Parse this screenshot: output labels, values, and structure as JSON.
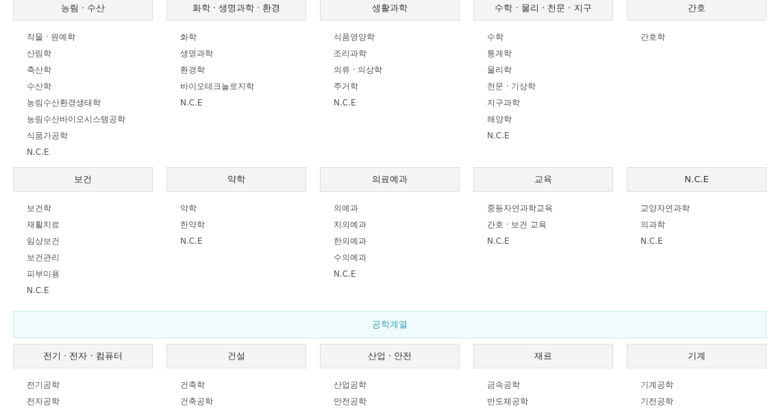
{
  "sections": [
    {
      "kind": "group",
      "columns": [
        {
          "title": "농림 · 수산",
          "items": [
            "작물 · 원예학",
            "산림학",
            "축산학",
            "수산학",
            "농림수산환경생태학",
            "농림수산바이오시스템공학",
            "식품가공학",
            "N.C.E"
          ]
        },
        {
          "title": "화학 · 생명과학 · 환경",
          "items": [
            "화학",
            "생명과학",
            "환경학",
            "바이오테크놀로지학",
            "N.C.E"
          ]
        },
        {
          "title": "생활과학",
          "items": [
            "식품영양학",
            "조리과학",
            "의류 · 의상학",
            "주거학",
            "N.C.E"
          ]
        },
        {
          "title": "수학 · 물리 · 천문 · 지구",
          "items": [
            "수학",
            "통계학",
            "물리학",
            "천문 · 기상학",
            "지구과학",
            "해양학",
            "N.C.E"
          ]
        },
        {
          "title": "간호",
          "items": [
            "간호학"
          ]
        }
      ]
    },
    {
      "kind": "group",
      "columns": [
        {
          "title": "보건",
          "items": [
            "보건학",
            "재활치료",
            "임상보건",
            "보건관리",
            "피부미용",
            "N.C.E"
          ]
        },
        {
          "title": "약학",
          "items": [
            "약학",
            "한약학",
            "N.C.E"
          ]
        },
        {
          "title": "의료예과",
          "items": [
            "의예과",
            "치의예과",
            "한의예과",
            "수의예과",
            "N.C.E"
          ]
        },
        {
          "title": "교육",
          "items": [
            "중등자연과학교육",
            "간호 · 보건 교육",
            "N.C.E"
          ]
        },
        {
          "title": "N.C.E",
          "items": [
            "교양자연과학",
            "의과학",
            "N.C.E"
          ]
        }
      ]
    },
    {
      "kind": "banner",
      "title": "공학계열"
    },
    {
      "kind": "group",
      "columns": [
        {
          "title": "전기 · 전자 · 컴퓨터",
          "items": [
            "전기공학",
            "전자공학"
          ]
        },
        {
          "title": "건설",
          "items": [
            "건축학",
            "건축공학"
          ]
        },
        {
          "title": "산업 · 안전",
          "items": [
            "산업공학",
            "안전공학"
          ]
        },
        {
          "title": "재료",
          "items": [
            "금속공학",
            "반도체공학"
          ]
        },
        {
          "title": "기계",
          "items": [
            "기계공학",
            "기전공학"
          ]
        }
      ]
    }
  ]
}
